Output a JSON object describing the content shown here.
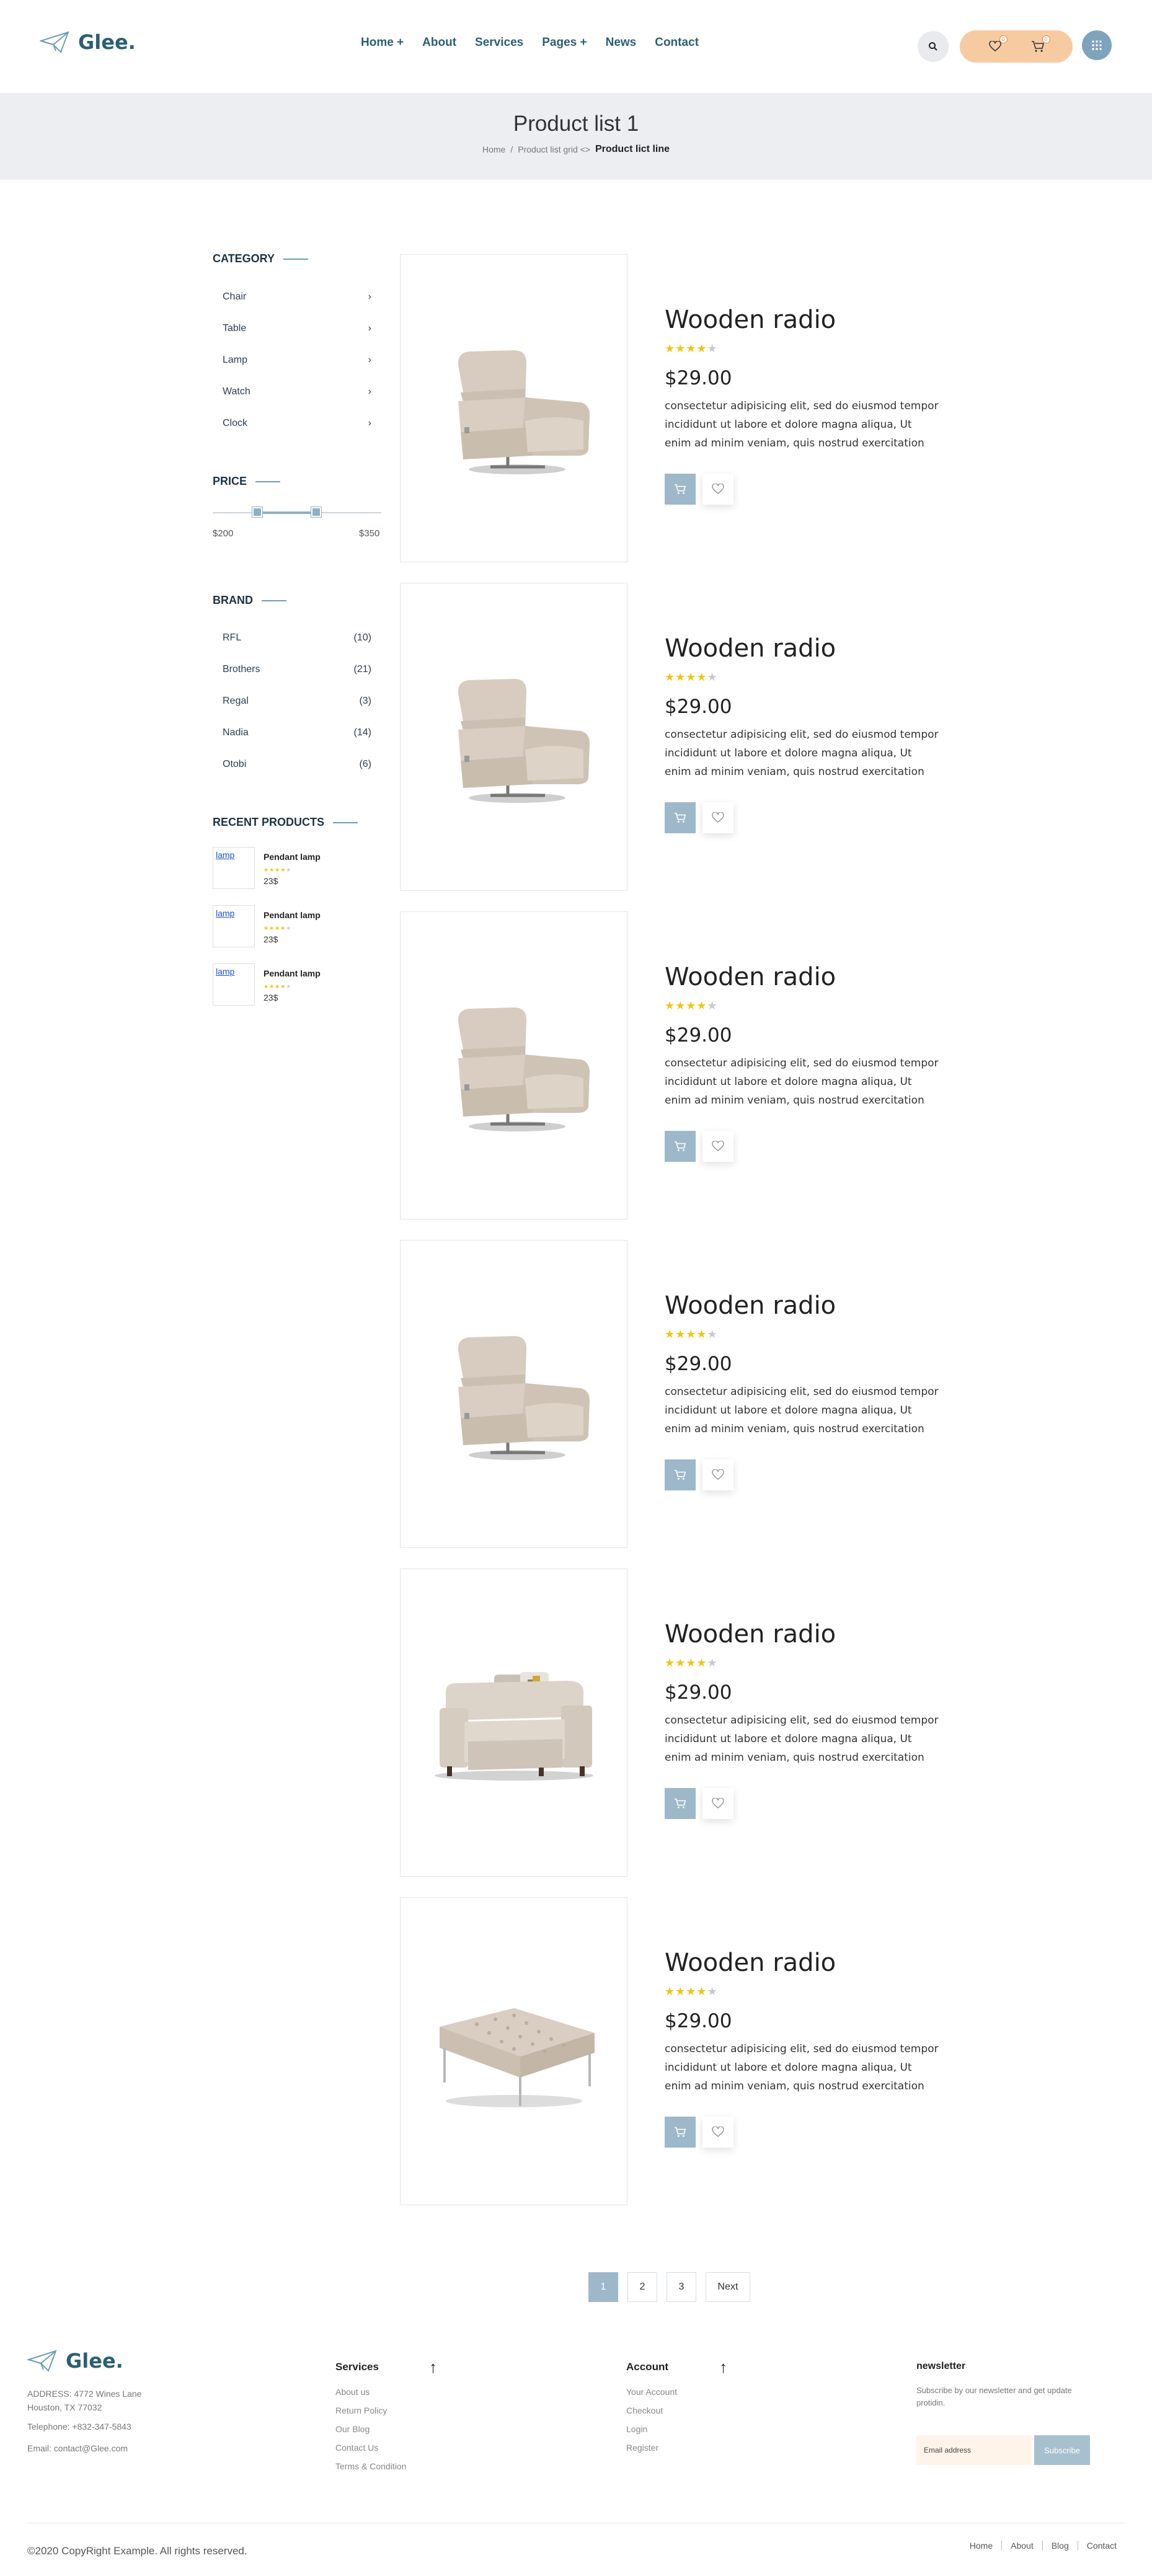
{
  "header": {
    "logo_text": "Glee.",
    "nav": [
      "Home +",
      "About",
      "Services",
      "Pages +",
      "News",
      "Contact"
    ],
    "wishlist_count": "0",
    "cart_count": "0",
    "icons": {
      "search": "search-icon",
      "wishlist": "heart-icon",
      "cart": "cart-icon",
      "menu": "grid-menu-icon"
    }
  },
  "banner": {
    "title": "Product list 1",
    "crumb_home": "Home",
    "crumb_sep": "/",
    "crumb_mid": "Product list grid <>",
    "crumb_current": "Product lict line"
  },
  "sidebar": {
    "category_title": "CATEGORY",
    "categories": [
      "Chair",
      "Table",
      "Lamp",
      "Watch",
      "Clock"
    ],
    "price_title": "PRICE",
    "price_min": "$200",
    "price_max": "$350",
    "brand_title": "BRAND",
    "brands": [
      {
        "name": "RFL",
        "count": "(10)"
      },
      {
        "name": "Brothers",
        "count": "(21)"
      },
      {
        "name": "Regal",
        "count": "(3)"
      },
      {
        "name": "Nadia",
        "count": "(14)"
      },
      {
        "name": "Otobi",
        "count": "(6)"
      }
    ],
    "recent_title": "RECENT PRODUCTS",
    "recent": [
      {
        "alt": "lamp",
        "name": "Pendant lamp",
        "rating": 4,
        "price": "23$"
      },
      {
        "alt": "lamp",
        "name": "Pendant lamp",
        "rating": 4,
        "price": "23$"
      },
      {
        "alt": "lamp",
        "name": "Pendant lamp",
        "rating": 4,
        "price": "23$"
      }
    ]
  },
  "products": [
    {
      "image": "recliner-chair",
      "title": "Wooden radio",
      "rating": 4,
      "price": "$29.00",
      "desc": "consectetur adipisicing elit, sed do eiusmod tempor incididunt ut labore et dolore magna aliqua, Ut enim ad minim veniam, quis nostrud exercitation"
    },
    {
      "image": "recliner-chair",
      "title": "Wooden radio",
      "rating": 4,
      "price": "$29.00",
      "desc": "consectetur adipisicing elit, sed do eiusmod tempor incididunt ut labore et dolore magna aliqua, Ut enim ad minim veniam, quis nostrud exercitation"
    },
    {
      "image": "recliner-chair",
      "title": "Wooden radio",
      "rating": 4,
      "price": "$29.00",
      "desc": "consectetur adipisicing elit, sed do eiusmod tempor incididunt ut labore et dolore magna aliqua, Ut enim ad minim veniam, quis nostrud exercitation"
    },
    {
      "image": "recliner-chair",
      "title": "Wooden radio",
      "rating": 4,
      "price": "$29.00",
      "desc": "consectetur adipisicing elit, sed do eiusmod tempor incididunt ut labore et dolore magna aliqua, Ut enim ad minim veniam, quis nostrud exercitation"
    },
    {
      "image": "armchair",
      "title": "Wooden radio",
      "rating": 4,
      "price": "$29.00",
      "desc": "consectetur adipisicing elit, sed do eiusmod tempor incididunt ut labore et dolore magna aliqua, Ut enim ad minim veniam, quis nostrud exercitation"
    },
    {
      "image": "ottoman",
      "title": "Wooden radio",
      "rating": 4,
      "price": "$29.00",
      "desc": "consectetur adipisicing elit, sed do eiusmod tempor incididunt ut labore et dolore magna aliqua, Ut enim ad minim veniam, quis nostrud exercitation"
    }
  ],
  "pagination": {
    "pages": [
      "1",
      "2",
      "3"
    ],
    "next": "Next",
    "active": "1"
  },
  "footer": {
    "logo_text": "Glee.",
    "address": "ADDRESS: 4772 Wines Lane Houston, TX 77032",
    "telephone": "Telephone: +832-347-5843",
    "email": "Email: contact@Glee.com",
    "services_title": "Services",
    "services": [
      "About us",
      "Return Policy",
      "Our Blog",
      "Contact Us",
      "Terms & Condition"
    ],
    "account_title": "Account",
    "account": [
      "Your Account",
      "Checkout",
      "Login",
      "Register"
    ],
    "newsletter_title": "newsletter",
    "newsletter_text": "Subscribe by our newsletter and get update protidin.",
    "email_placeholder": "Email address",
    "subscribe": "Subscribe",
    "copyright": "©2020 CopyRight Example. All rights reserved.",
    "bottom_links": [
      "Home",
      "About",
      "Blog",
      "Contact"
    ],
    "arrow": "↑"
  },
  "colors": {
    "brand": "#2c5f73",
    "accent": "#9db8c9",
    "pill": "#f7cba2",
    "star": "#f1c40f",
    "banner": "#eceef1"
  }
}
